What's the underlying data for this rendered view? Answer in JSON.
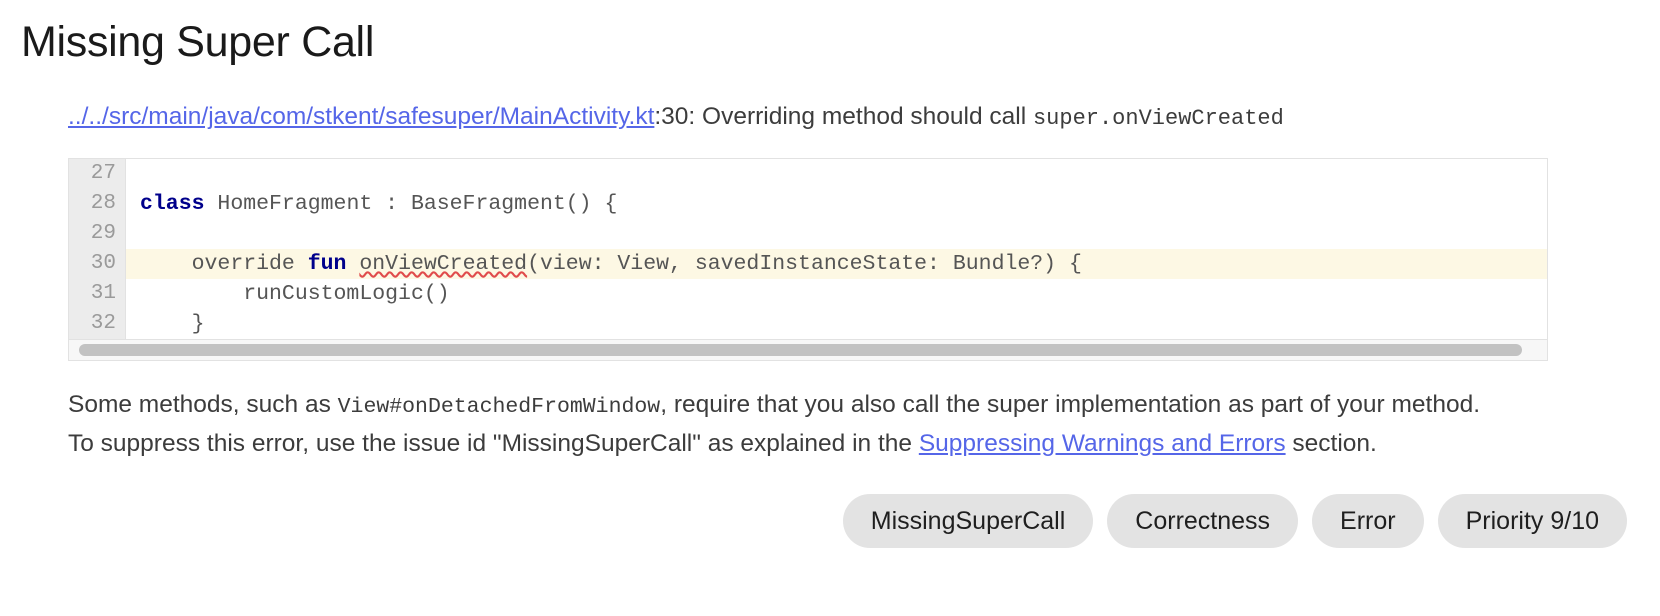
{
  "page_title": "Missing Super Call",
  "issue": {
    "location": {
      "file_link": "../../src/main/java/com/stkent/safesuper/MainActivity.kt",
      "line_suffix": ":30: Overriding method should call ",
      "method_code": "super.onViewCreated"
    },
    "code_snippet": {
      "lines": [
        {
          "number": "27",
          "text": "",
          "highlight": false
        },
        {
          "number": "28",
          "text": "class HomeFragment : BaseFragment() {",
          "highlight": false
        },
        {
          "number": "29",
          "text": "",
          "highlight": false
        },
        {
          "number": "30",
          "text": "    override fun onViewCreated(view: View, savedInstanceState: Bundle?) {",
          "highlight": true
        },
        {
          "number": "31",
          "text": "        runCustomLogic()",
          "highlight": false
        },
        {
          "number": "32",
          "text": "    }",
          "highlight": false
        }
      ],
      "l27": "",
      "l28_kw": "class",
      "l28_rest": " HomeFragment : BaseFragment() {",
      "l29": "",
      "l30_a": "    override ",
      "l30_kw": "fun",
      "l30_b": " ",
      "l30_err": "onViewCreated",
      "l30_c": "(view: View, savedInstanceState: Bundle?) {",
      "l31": "        runCustomLogic()",
      "l32": "    }",
      "n27": "27",
      "n28": "28",
      "n29": "29",
      "n30": "30",
      "n31": "31",
      "n32": "32"
    },
    "description": {
      "part1": "Some methods, such as ",
      "code": "View#onDetachedFromWindow",
      "part2": ", require that you also call the super implementation as part of your method."
    },
    "suppress": {
      "part1": "To suppress this error, use the issue id \"MissingSuperCall\" as explained in the ",
      "link_text": "Suppressing Warnings and Errors",
      "part2": " section."
    },
    "badges": [
      "MissingSuperCall",
      "Correctness",
      "Error",
      "Priority 9/10"
    ],
    "badge_0": "MissingSuperCall",
    "badge_1": "Correctness",
    "badge_2": "Error",
    "badge_3": "Priority 9/10"
  },
  "colors": {
    "link": "#5566e8",
    "highlight_line": "#fdf8e4",
    "badge_bg": "#e3e3e3",
    "error_squiggle": "#e04b4b",
    "keyword": "#00008b"
  }
}
